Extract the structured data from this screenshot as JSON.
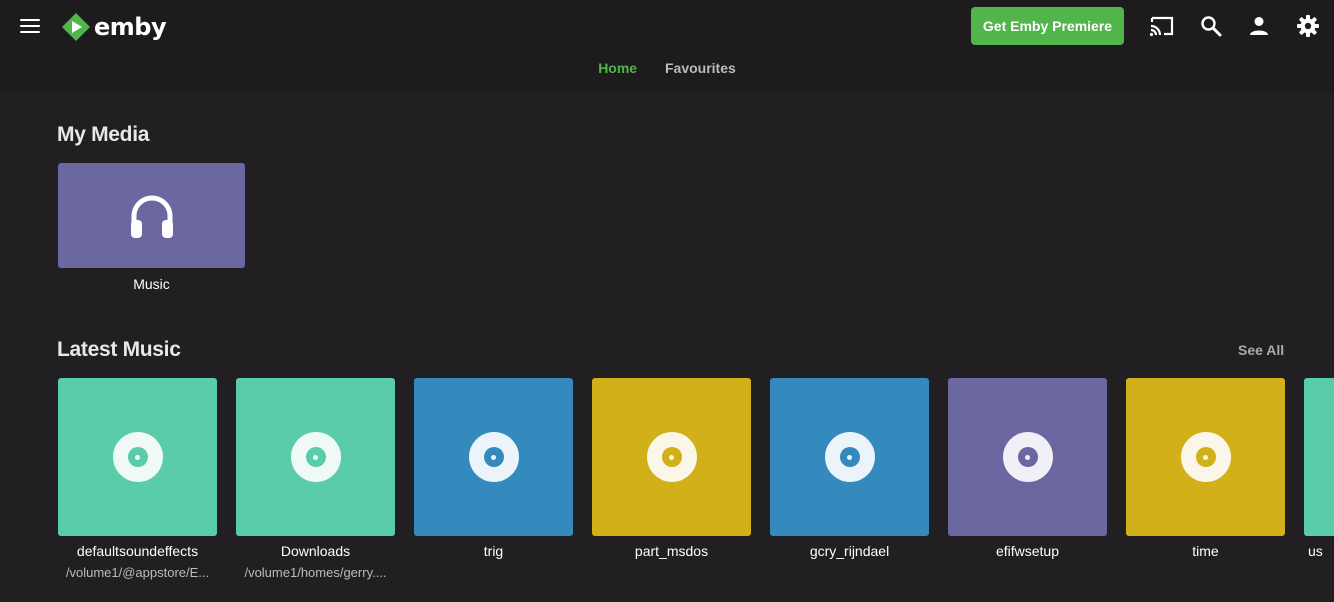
{
  "header": {
    "logo_text": "emby",
    "premiere_label": "Get Emby Premiere",
    "icons": [
      "menu-icon",
      "cast-icon",
      "search-icon",
      "user-icon",
      "settings-icon"
    ]
  },
  "tabs": [
    {
      "label": "Home",
      "active": true
    },
    {
      "label": "Favourites",
      "active": false
    }
  ],
  "my_media": {
    "title": "My Media",
    "libraries": [
      {
        "label": "Music",
        "icon": "headphones-icon",
        "color": "#6b67a0"
      }
    ]
  },
  "latest_music": {
    "title": "Latest Music",
    "see_all": "See All",
    "items": [
      {
        "title": "defaultsoundeffects",
        "subtitle": "/volume1/@appstore/E...",
        "color": "#5bccaa"
      },
      {
        "title": "Downloads",
        "subtitle": "/volume1/homes/gerry....",
        "color": "#5bccaa"
      },
      {
        "title": "trig",
        "subtitle": "",
        "color": "#348abc"
      },
      {
        "title": "part_msdos",
        "subtitle": "",
        "color": "#d1b019"
      },
      {
        "title": "gcry_rijndael",
        "subtitle": "",
        "color": "#348abc"
      },
      {
        "title": "efifwsetup",
        "subtitle": "",
        "color": "#6b67a0"
      },
      {
        "title": "time",
        "subtitle": "",
        "color": "#d1b019"
      },
      {
        "title": "us",
        "subtitle": "",
        "color": "#5bccaa"
      }
    ]
  },
  "colors": {
    "accent": "#52b54b",
    "background": "#221f22",
    "header": "#1d1b1d"
  }
}
